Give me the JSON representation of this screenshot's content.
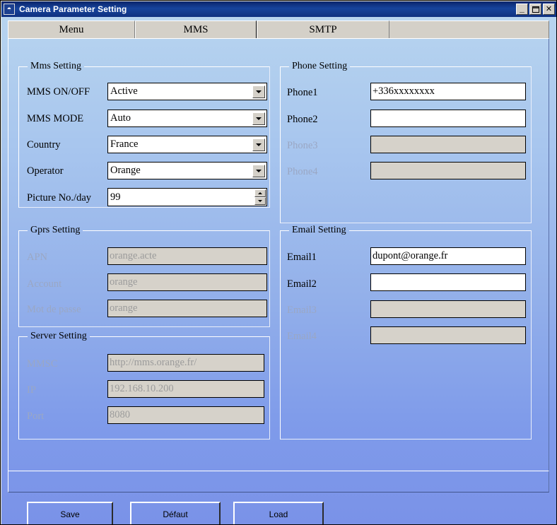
{
  "window": {
    "title": "Camera Parameter Setting",
    "icon": "app-icon",
    "buttons": {
      "minimize": "_",
      "maximize": "□",
      "close": "X"
    }
  },
  "tabs": [
    {
      "label": "Menu",
      "selected": false
    },
    {
      "label": "MMS",
      "selected": true
    },
    {
      "label": "SMTP",
      "selected": false
    }
  ],
  "groups": {
    "mms": {
      "title": "Mms Setting",
      "fields": [
        {
          "label": "MMS ON/OFF",
          "value": "Active",
          "type": "combo"
        },
        {
          "label": "MMS MODE",
          "value": "Auto",
          "type": "combo"
        },
        {
          "label": "Country",
          "value": "France",
          "type": "combo"
        },
        {
          "label": "Operator",
          "value": "Orange",
          "type": "combo"
        },
        {
          "label": "Picture No./day",
          "value": "99",
          "type": "spin"
        }
      ]
    },
    "gprs": {
      "title": "Gprs Setting",
      "fields": [
        {
          "label": "APN",
          "value": "orange.acte",
          "disabled": true
        },
        {
          "label": "Account",
          "value": "orange",
          "disabled": true
        },
        {
          "label": "Mot de passe",
          "value": "orange",
          "disabled": true
        }
      ]
    },
    "server": {
      "title": "Server Setting",
      "fields": [
        {
          "label": "MMSC",
          "value": "http://mms.orange.fr/",
          "disabled": true
        },
        {
          "label": "IP",
          "value": "192.168.10.200",
          "disabled": true
        },
        {
          "label": "Port",
          "value": "8080",
          "disabled": true
        }
      ]
    },
    "phone": {
      "title": "Phone Setting",
      "fields": [
        {
          "label": "Phone1",
          "value": "+336xxxxxxxx",
          "disabled": false
        },
        {
          "label": "Phone2",
          "value": "",
          "disabled": false
        },
        {
          "label": "Phone3",
          "value": "",
          "disabled": true
        },
        {
          "label": "Phone4",
          "value": "",
          "disabled": true
        }
      ]
    },
    "email": {
      "title": "Email Setting",
      "fields": [
        {
          "label": "Email1",
          "value": "dupont@orange.fr",
          "disabled": false
        },
        {
          "label": "Email2",
          "value": "",
          "disabled": false
        },
        {
          "label": "Email3",
          "value": "",
          "disabled": true
        },
        {
          "label": "Email4",
          "value": "",
          "disabled": true
        }
      ]
    }
  },
  "footer": {
    "buttons": [
      {
        "label": "Save"
      },
      {
        "label": "Défaut"
      },
      {
        "label": "Load"
      }
    ]
  },
  "colors": {
    "titlebar_start": "#0a246a",
    "titlebar_end": "#0f3180",
    "client_top": "#b7d4ef",
    "client_bottom": "#7a92e8",
    "tab_face": "#d4d0c8",
    "disabled_field": "#d6d2ca",
    "disabled_text": "#9b9b9b",
    "disabled_label": "#9aa7c4"
  }
}
